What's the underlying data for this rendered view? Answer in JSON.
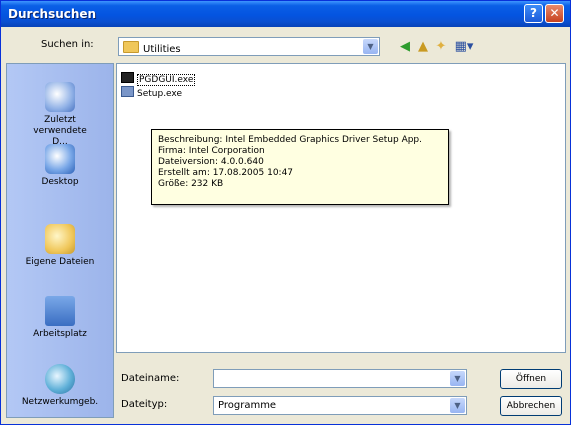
{
  "window": {
    "title": "Durchsuchen",
    "help_label": "?",
    "close_label": "✕"
  },
  "toolbar": {
    "look_in_label": "Suchen in:",
    "look_in_value": "Utilities",
    "tools": [
      "back-arrow-icon",
      "up-folder-icon",
      "new-folder-icon",
      "view-menu-icon"
    ]
  },
  "places": [
    {
      "label": "Zuletzt verwendete D...",
      "icon": "recent-documents-icon"
    },
    {
      "label": "Desktop",
      "icon": "desktop-icon"
    },
    {
      "label": "Eigene Dateien",
      "icon": "my-documents-icon"
    },
    {
      "label": "Arbeitsplatz",
      "icon": "my-computer-icon"
    },
    {
      "label": "Netzwerkumgeb.",
      "icon": "network-places-icon"
    }
  ],
  "files": [
    {
      "name": "PGDGUI.exe",
      "selected": true
    },
    {
      "name": "Setup.exe",
      "selected": false
    }
  ],
  "tooltip": {
    "description": "Beschreibung: Intel Embedded Graphics Driver Setup App.",
    "company": "Firma: Intel Corporation",
    "version": "Dateiversion: 4.0.0.640",
    "created": "Erstellt am: 17.08.2005 10:47",
    "size": "Größe: 232 KB"
  },
  "footer": {
    "filename_label": "Dateiname:",
    "filename_value": "",
    "filetype_label": "Dateityp:",
    "filetype_value": "Programme",
    "open_label": "Öffnen",
    "cancel_label": "Abbrechen"
  },
  "colors": {
    "titlebar": "#0454e0",
    "dialog_bg": "#ece9d8",
    "places_bg": "#9cb4ea",
    "tooltip_bg": "#ffffe1"
  }
}
